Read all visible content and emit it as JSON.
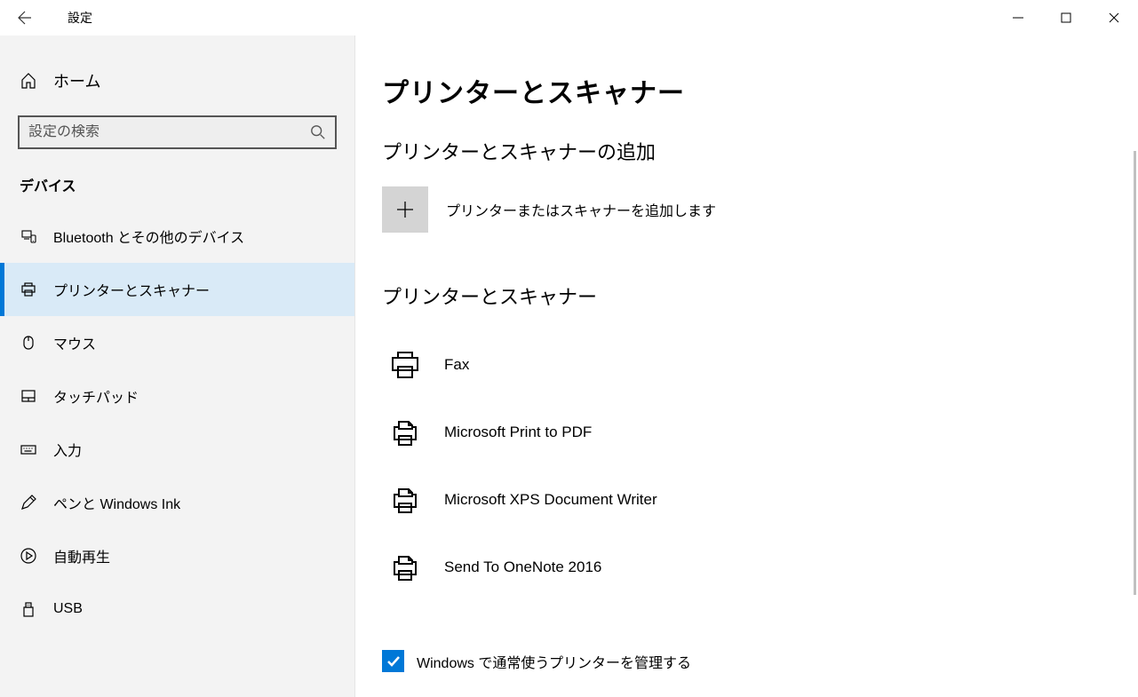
{
  "titlebar": {
    "title": "設定"
  },
  "sidebar": {
    "home_label": "ホーム",
    "search_placeholder": "設定の検索",
    "category": "デバイス",
    "items": [
      {
        "label": "Bluetooth とその他のデバイス",
        "selected": false
      },
      {
        "label": "プリンターとスキャナー",
        "selected": true
      },
      {
        "label": "マウス",
        "selected": false
      },
      {
        "label": "タッチパッド",
        "selected": false
      },
      {
        "label": "入力",
        "selected": false
      },
      {
        "label": "ペンと Windows Ink",
        "selected": false
      },
      {
        "label": "自動再生",
        "selected": false
      },
      {
        "label": "USB",
        "selected": false
      }
    ]
  },
  "content": {
    "page_title": "プリンターとスキャナー",
    "add_section_title": "プリンターとスキャナーの追加",
    "add_label": "プリンターまたはスキャナーを追加します",
    "list_section_title": "プリンターとスキャナー",
    "printers": [
      {
        "name": "Fax"
      },
      {
        "name": "Microsoft Print to PDF"
      },
      {
        "name": "Microsoft XPS Document Writer"
      },
      {
        "name": "Send To OneNote 2016"
      }
    ],
    "checkbox_label": "Windows で通常使うプリンターを管理する",
    "checkbox_checked": true
  }
}
